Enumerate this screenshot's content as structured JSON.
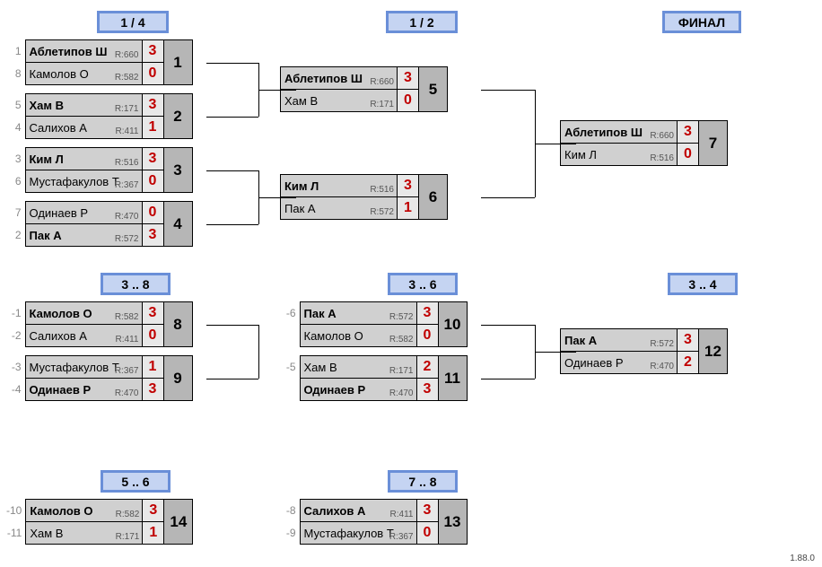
{
  "round_labels": {
    "qf": "1 / 4",
    "sf": "1 / 2",
    "f": "ФИНАЛ",
    "c38": "3 .. 8",
    "c36": "3 .. 6",
    "c34": "3 .. 4",
    "c56": "5 .. 6",
    "c78": "7 .. 8"
  },
  "matches": {
    "m1": {
      "id": "1",
      "p1": {
        "seed": "1",
        "name": "Аблетипов Ш",
        "rating": "R:660",
        "score": "3",
        "winner": true
      },
      "p2": {
        "seed": "8",
        "name": "Камолов О",
        "rating": "R:582",
        "score": "0",
        "winner": false
      }
    },
    "m2": {
      "id": "2",
      "p1": {
        "seed": "5",
        "name": "Хам В",
        "rating": "R:171",
        "score": "3",
        "winner": true
      },
      "p2": {
        "seed": "4",
        "name": "Салихов А",
        "rating": "R:411",
        "score": "1",
        "winner": false
      }
    },
    "m3": {
      "id": "3",
      "p1": {
        "seed": "3",
        "name": "Ким Л",
        "rating": "R:516",
        "score": "3",
        "winner": true
      },
      "p2": {
        "seed": "6",
        "name": "Мустафакулов Т",
        "rating": "R:367",
        "score": "0",
        "winner": false
      }
    },
    "m4": {
      "id": "4",
      "p1": {
        "seed": "7",
        "name": "Одинаев Р",
        "rating": "R:470",
        "score": "0",
        "winner": false
      },
      "p2": {
        "seed": "2",
        "name": "Пак А",
        "rating": "R:572",
        "score": "3",
        "winner": true
      }
    },
    "m5": {
      "id": "5",
      "p1": {
        "seed": "",
        "name": "Аблетипов Ш",
        "rating": "R:660",
        "score": "3",
        "winner": true
      },
      "p2": {
        "seed": "",
        "name": "Хам В",
        "rating": "R:171",
        "score": "0",
        "winner": false
      }
    },
    "m6": {
      "id": "6",
      "p1": {
        "seed": "",
        "name": "Ким Л",
        "rating": "R:516",
        "score": "3",
        "winner": true
      },
      "p2": {
        "seed": "",
        "name": "Пак А",
        "rating": "R:572",
        "score": "1",
        "winner": false
      }
    },
    "m7": {
      "id": "7",
      "p1": {
        "seed": "",
        "name": "Аблетипов Ш",
        "rating": "R:660",
        "score": "3",
        "winner": true
      },
      "p2": {
        "seed": "",
        "name": "Ким Л",
        "rating": "R:516",
        "score": "0",
        "winner": false
      }
    },
    "m8": {
      "id": "8",
      "p1": {
        "seed": "-1",
        "name": "Камолов О",
        "rating": "R:582",
        "score": "3",
        "winner": true
      },
      "p2": {
        "seed": "-2",
        "name": "Салихов А",
        "rating": "R:411",
        "score": "0",
        "winner": false
      }
    },
    "m9": {
      "id": "9",
      "p1": {
        "seed": "-3",
        "name": "Мустафакулов Т",
        "rating": "R:367",
        "score": "1",
        "winner": false
      },
      "p2": {
        "seed": "-4",
        "name": "Одинаев Р",
        "rating": "R:470",
        "score": "3",
        "winner": true
      }
    },
    "m10": {
      "id": "10",
      "p1": {
        "seed": "-6",
        "name": "Пак А",
        "rating": "R:572",
        "score": "3",
        "winner": true
      },
      "p2": {
        "seed": "",
        "name": "Камолов О",
        "rating": "R:582",
        "score": "0",
        "winner": false
      }
    },
    "m11": {
      "id": "11",
      "p1": {
        "seed": "-5",
        "name": "Хам В",
        "rating": "R:171",
        "score": "2",
        "winner": false
      },
      "p2": {
        "seed": "",
        "name": "Одинаев Р",
        "rating": "R:470",
        "score": "3",
        "winner": true
      }
    },
    "m12": {
      "id": "12",
      "p1": {
        "seed": "",
        "name": "Пак А",
        "rating": "R:572",
        "score": "3",
        "winner": true
      },
      "p2": {
        "seed": "",
        "name": "Одинаев Р",
        "rating": "R:470",
        "score": "2",
        "winner": false
      }
    },
    "m13": {
      "id": "13",
      "p1": {
        "seed": "-8",
        "name": "Салихов А",
        "rating": "R:411",
        "score": "3",
        "winner": true
      },
      "p2": {
        "seed": "-9",
        "name": "Мустафакулов Т",
        "rating": "R:367",
        "score": "0",
        "winner": false
      }
    },
    "m14": {
      "id": "14",
      "p1": {
        "seed": "-10",
        "name": "Камолов О",
        "rating": "R:582",
        "score": "3",
        "winner": true
      },
      "p2": {
        "seed": "-11",
        "name": "Хам В",
        "rating": "R:171",
        "score": "1",
        "winner": false
      }
    }
  },
  "version": "1.88.0"
}
